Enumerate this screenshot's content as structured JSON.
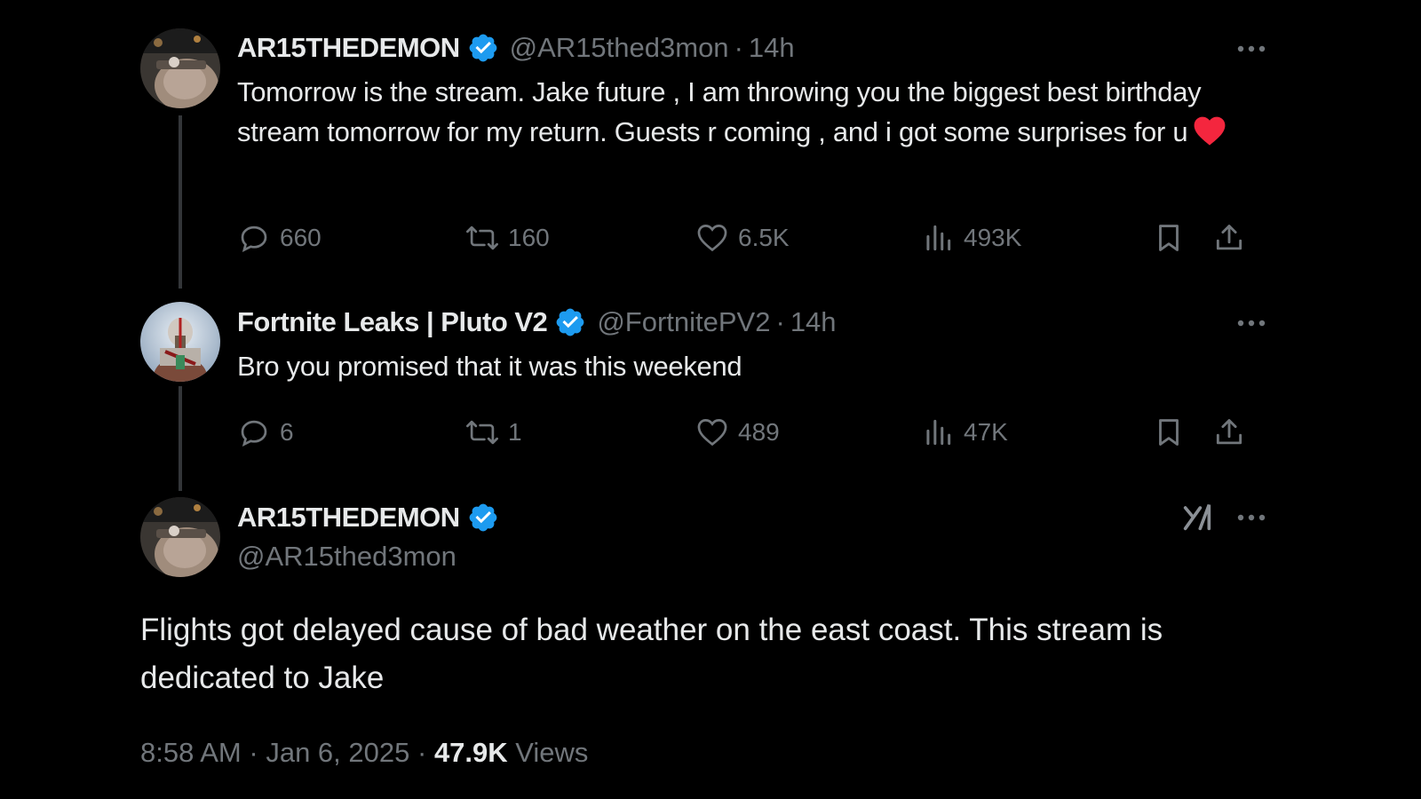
{
  "colors": {
    "background": "#000000",
    "text_primary": "#e7e9ea",
    "text_secondary": "#71767b",
    "verified_blue": "#1d9bf0",
    "heart_red": "#f91880",
    "thread_line": "#333639"
  },
  "tweets": [
    {
      "name": "AR15THEDEMON",
      "handle": "@AR15thed3mon",
      "separator": "·",
      "time": "14h",
      "text": "Tomorrow is the stream. Jake future , I am throwing you the biggest best birthday stream tomorrow for my return. Guests r coming , and i got some surprises for u",
      "emoji": "red-heart-emoji",
      "actions": {
        "replies": "660",
        "reposts": "160",
        "likes": "6.5K",
        "views": "493K"
      }
    },
    {
      "name": "Fortnite Leaks | Pluto V2",
      "handle": "@FortnitePV2",
      "separator": "·",
      "time": "14h",
      "text": "Bro you promised that it was this weekend",
      "actions": {
        "replies": "6",
        "reposts": "1",
        "likes": "489",
        "views": "47K"
      }
    }
  ],
  "main_tweet": {
    "name": "AR15THEDEMON",
    "handle": "@AR15thed3mon",
    "text": "Flights got delayed cause of bad weather on the east coast. This stream is dedicated to Jake",
    "time": "8:58 AM",
    "separator": "·",
    "date": "Jan 6, 2025",
    "views_count": "47.9K",
    "views_label": "Views"
  },
  "icons": {
    "verified": "verified-badge-icon",
    "more": "more-icon",
    "reply": "reply-icon",
    "repost": "repost-icon",
    "like": "like-icon",
    "views": "views-icon",
    "bookmark": "bookmark-icon",
    "share": "share-icon",
    "grok": "grok-icon"
  }
}
